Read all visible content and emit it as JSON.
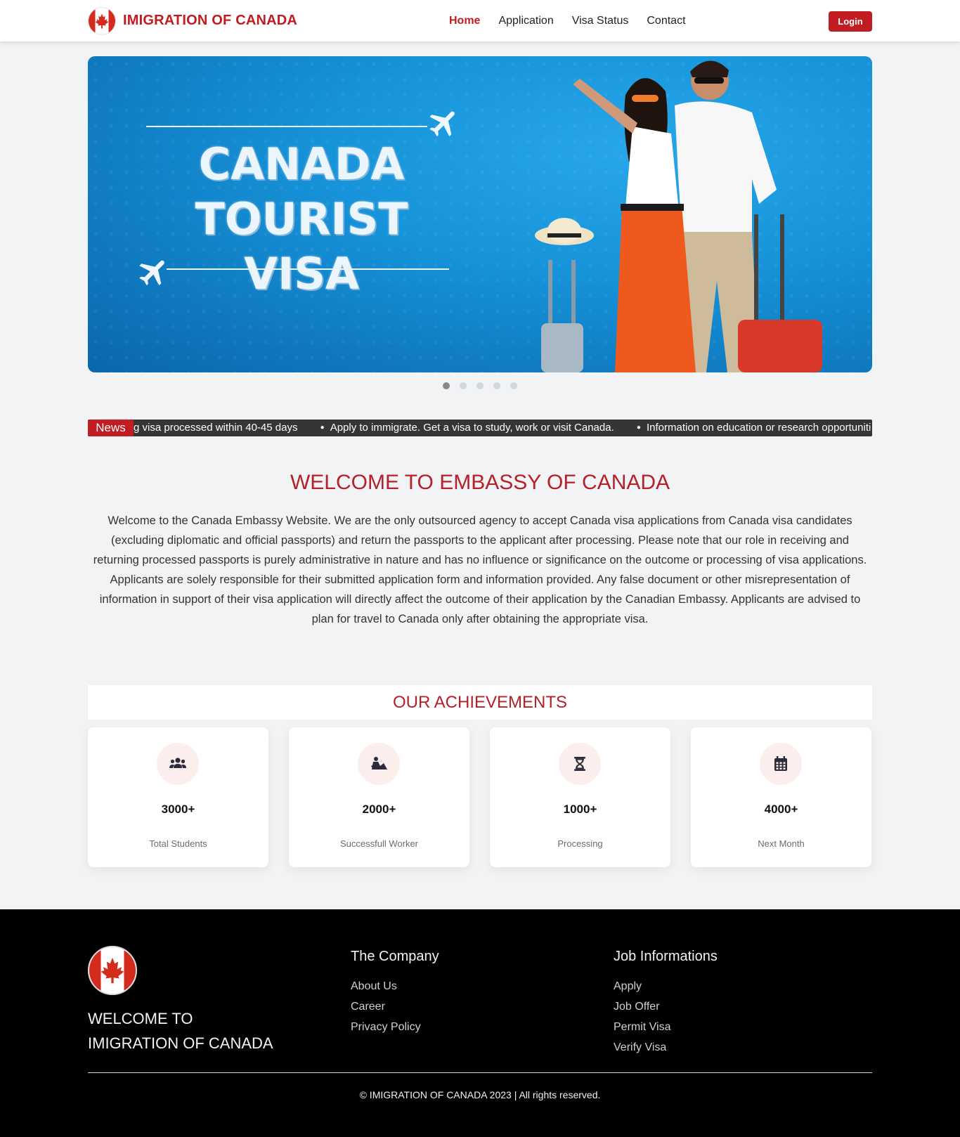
{
  "brand": {
    "name": "IMIGRATION OF CANADA"
  },
  "nav": {
    "items": [
      "Home",
      "Application",
      "Visa Status",
      "Contact"
    ],
    "active": "Home",
    "login_label": "Login"
  },
  "hero": {
    "title_line1": "CANADA",
    "title_line2": "TOURIST VISA",
    "slides": 5,
    "active_slide": 1
  },
  "news": {
    "label": "News",
    "items": [
      "g visa processed within 40-45 days",
      "Apply to immigrate. Get a visa to study, work or visit Canada.",
      "Information on education or research opportuniti"
    ]
  },
  "welcome": {
    "title": "WELCOME TO EMBASSY OF CANADA",
    "text": "Welcome to the Canada Embassy Website. We are the only outsourced agency to accept Canada visa applications from Canada visa candidates (excluding diplomatic and official passports) and return the passports to the applicant after processing. Please note that our role in receiving and returning processed passports is purely administrative in nature and has no influence or significance on the outcome or processing of visa applications. Applicants are solely responsible for their submitted application form and information provided. Any false document or other misrepresentation of information in support of their visa application will directly affect the outcome of their application by the Canadian Embassy. Applicants are advised to plan for travel to Canada only after obtaining the appropriate visa."
  },
  "achievements": {
    "title": "OUR ACHIEVEMENTS",
    "cards": [
      {
        "icon": "users-icon",
        "value": "3000+",
        "label": "Total Students"
      },
      {
        "icon": "worker-icon",
        "value": "2000+",
        "label": "Successfull Worker"
      },
      {
        "icon": "hourglass-icon",
        "value": "1000+",
        "label": "Processing"
      },
      {
        "icon": "calendar-icon",
        "value": "4000+",
        "label": "Next Month"
      }
    ]
  },
  "footer": {
    "welcome_line1": "WELCOME TO",
    "welcome_line2": "IMIGRATION OF CANADA",
    "company": {
      "title": "The Company",
      "links": [
        "About Us",
        "Career",
        "Privacy Policy"
      ]
    },
    "jobs": {
      "title": "Job Informations",
      "links": [
        "Apply",
        "Job Offer",
        "Permit Visa",
        "Verify Visa"
      ]
    },
    "copyright": "© IMIGRATION OF CANADA 2023 | All rights reserved."
  },
  "colors": {
    "brand_red": "#c11c22",
    "hero_blue": "#1693d9",
    "footer_bg": "#000000"
  }
}
